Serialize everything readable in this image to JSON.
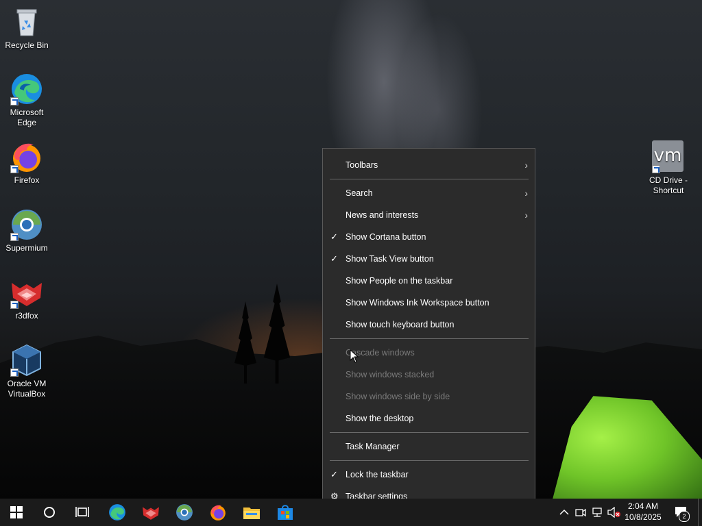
{
  "desktop": {
    "icons": [
      {
        "label": "Recycle Bin",
        "icon": "recycle-bin-icon"
      },
      {
        "label": "Microsoft Edge",
        "icon": "edge-icon"
      },
      {
        "label": "Firefox",
        "icon": "firefox-icon"
      },
      {
        "label": "Supermium",
        "icon": "supermium-icon"
      },
      {
        "label": "r3dfox",
        "icon": "r3dfox-icon"
      },
      {
        "label": "Oracle VM VirtualBox",
        "icon": "virtualbox-icon"
      },
      {
        "label": "CD Drive - Shortcut",
        "icon": "vmware-icon",
        "glyph_text": "vm"
      }
    ]
  },
  "context_menu": {
    "items": [
      {
        "label": "Toolbars",
        "submenu": true
      },
      {
        "label": "Search",
        "submenu": true
      },
      {
        "label": "News and interests",
        "submenu": true
      },
      {
        "label": "Show Cortana button",
        "checked": true
      },
      {
        "label": "Show Task View button",
        "checked": true
      },
      {
        "label": "Show People on the taskbar"
      },
      {
        "label": "Show Windows Ink Workspace button"
      },
      {
        "label": "Show touch keyboard button"
      },
      {
        "label": "Cascade windows",
        "disabled": true
      },
      {
        "label": "Show windows stacked",
        "disabled": true
      },
      {
        "label": "Show windows side by side",
        "disabled": true
      },
      {
        "label": "Show the desktop"
      },
      {
        "label": "Task Manager"
      },
      {
        "label": "Lock the taskbar",
        "checked": true
      },
      {
        "label": "Taskbar settings",
        "icon": "gear-icon"
      }
    ]
  },
  "taskbar": {
    "clock_time": "2:04 AM",
    "clock_date": "10/8/2025",
    "notification_count": "2",
    "pinned": [
      "start-icon",
      "search-icon",
      "task-view-icon",
      "edge-icon",
      "r3dfox-icon",
      "supermium-icon",
      "firefox-icon",
      "file-explorer-icon",
      "store-icon"
    ]
  },
  "colors": {
    "menu_bg": "#2b2b2b",
    "taskbar_bg": "#1b1b1b",
    "tent_green": "#7ed13a"
  }
}
